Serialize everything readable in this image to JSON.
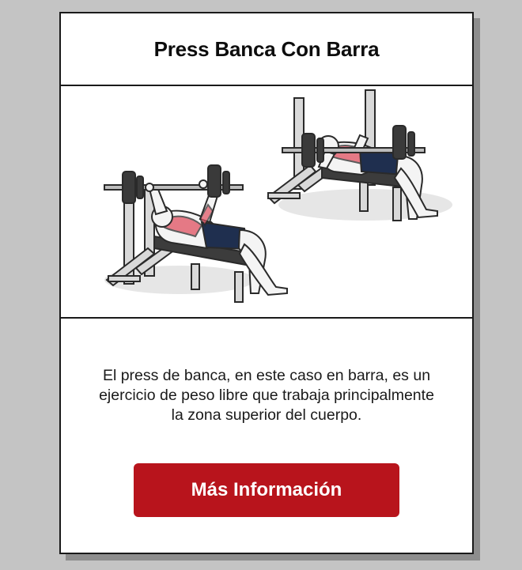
{
  "card": {
    "title": "Press Banca Con Barra",
    "illustration_icon": "bench-press-illustration",
    "description": "El press de banca, en este caso en barra, es un ejercicio de peso libre que trabaja principalmente la zona superior del cuerpo.",
    "button_label": "Más Información"
  },
  "colors": {
    "background": "#c4c4c4",
    "card": "#ffffff",
    "border": "#1a1a1a",
    "button": "#b8141c",
    "button_text": "#ffffff",
    "shorts": "#1f2f4f",
    "muscle_highlight": "#e05060"
  }
}
